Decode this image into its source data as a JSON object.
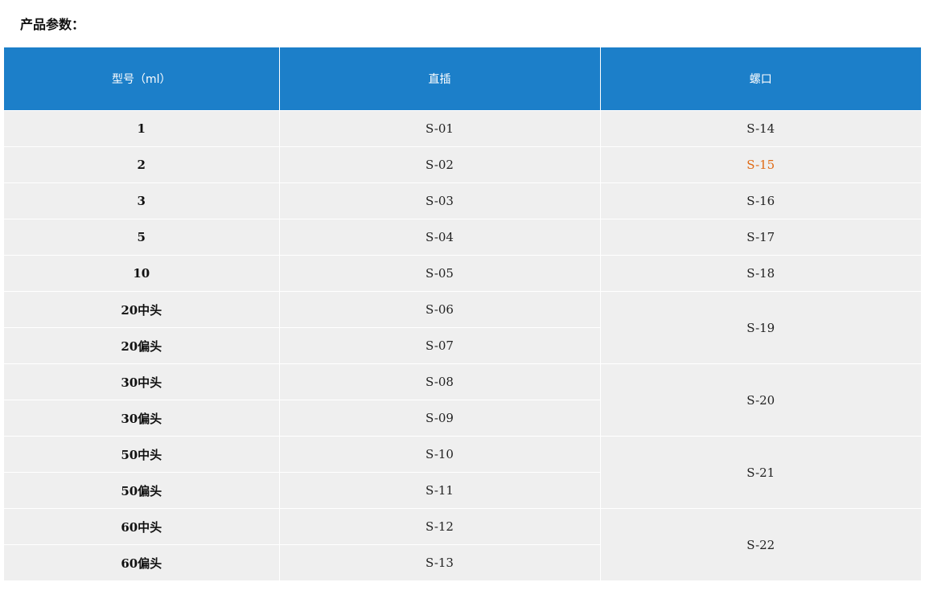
{
  "heading": "产品参数：",
  "table": {
    "headers": [
      "型号（ml）",
      "直插",
      "螺口"
    ],
    "rows": [
      {
        "model": "1",
        "direct": "S-01",
        "screw": "S-14"
      },
      {
        "model": "2",
        "direct": "S-02",
        "screw": "S-15"
      },
      {
        "model": "3",
        "direct": "S-03",
        "screw": "S-16"
      },
      {
        "model": "5",
        "direct": "S-04",
        "screw": "S-17"
      },
      {
        "model": "10",
        "direct": "S-05",
        "screw": "S-18"
      },
      {
        "model": "20中头",
        "direct": "S-06",
        "screw": "S-19"
      },
      {
        "model": "20偏头",
        "direct": "S-07"
      },
      {
        "model": "30中头",
        "direct": "S-08",
        "screw": "S-20"
      },
      {
        "model": "30偏头",
        "direct": "S-09"
      },
      {
        "model": "50中头",
        "direct": "S-10",
        "screw": "S-21"
      },
      {
        "model": "50偏头",
        "direct": "S-11"
      },
      {
        "model": "60中头",
        "direct": "S-12",
        "screw": "S-22"
      },
      {
        "model": "60偏头",
        "direct": "S-13"
      }
    ]
  },
  "colors": {
    "header_bg": "#1c7fc9",
    "row_bg": "#efefef",
    "highlight_text": "#e06a14"
  }
}
